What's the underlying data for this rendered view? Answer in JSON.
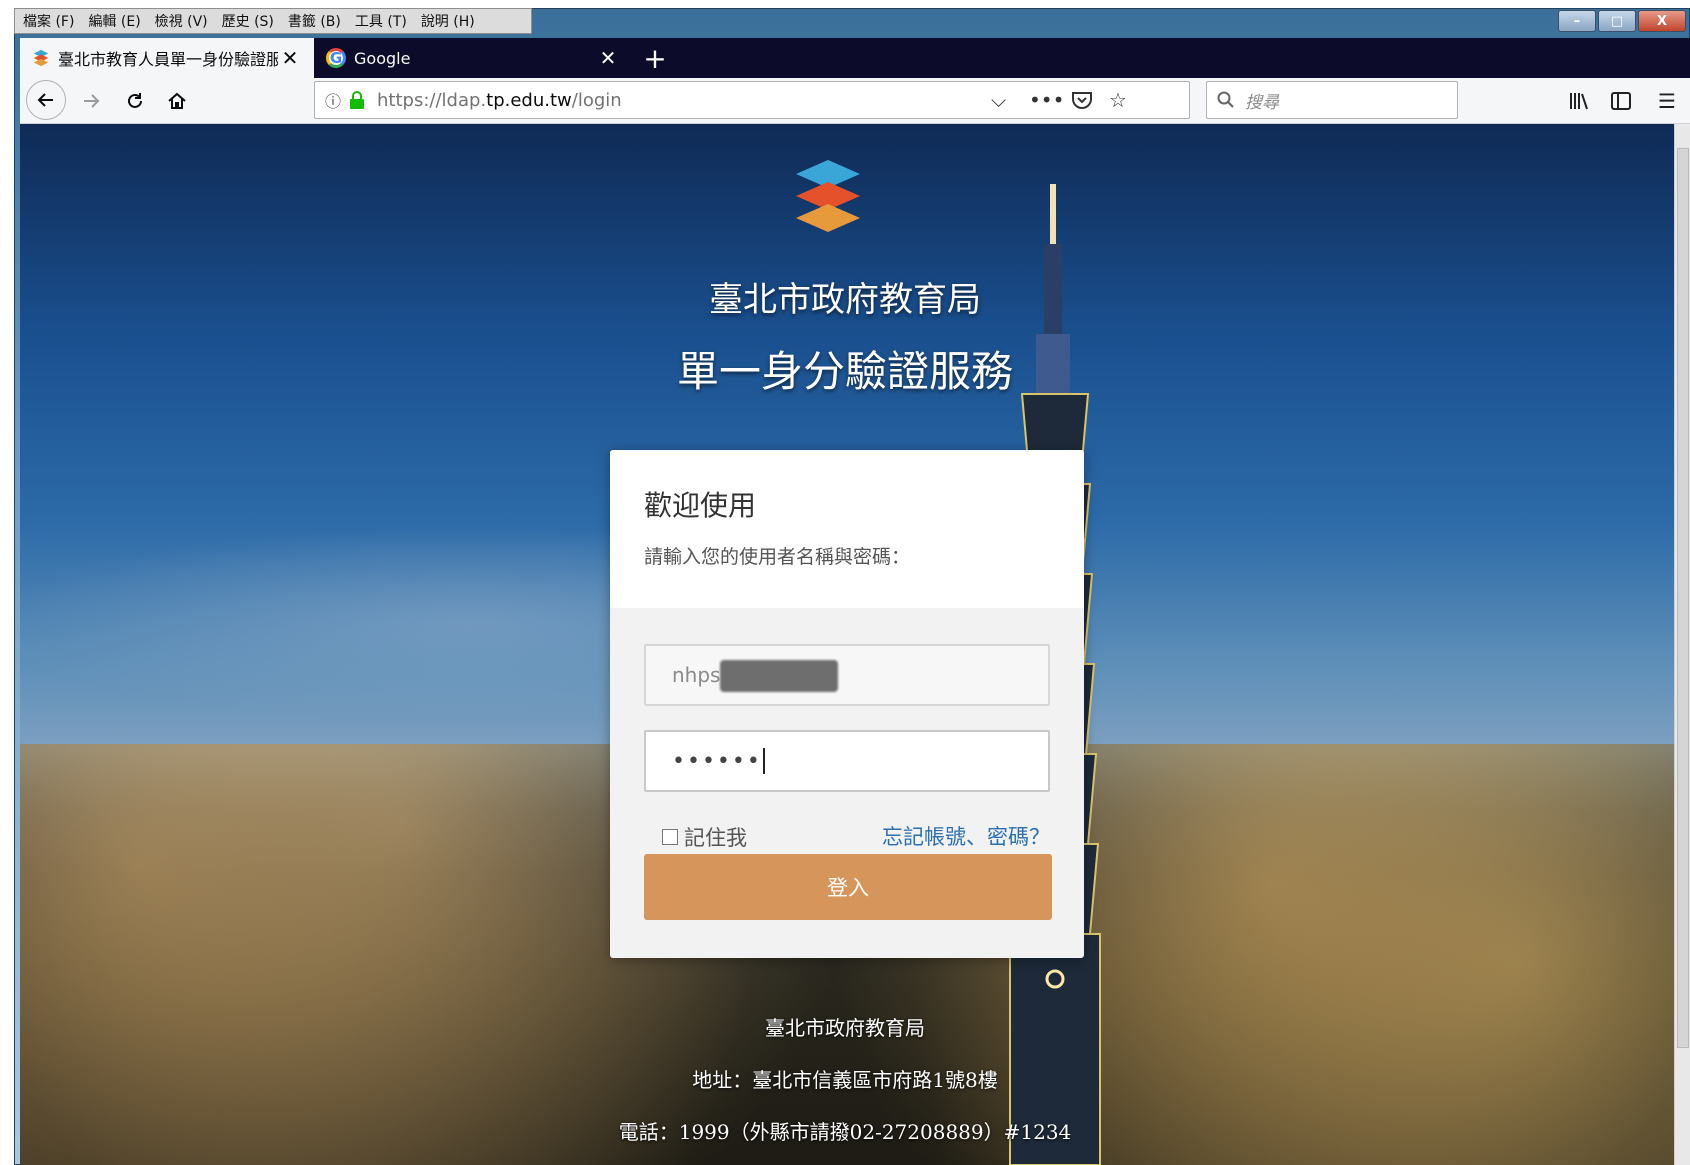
{
  "menubar": {
    "items": [
      "檔案 (F)",
      "編輯 (E)",
      "檢視 (V)",
      "歷史 (S)",
      "書籤 (B)",
      "工具 (T)",
      "說明 (H)"
    ]
  },
  "window_controls": {
    "minimize": "–",
    "maximize": "□",
    "close": "X"
  },
  "tabs": [
    {
      "title": "臺北市教育人員單一身份驗證服",
      "active": true,
      "close": "✕"
    },
    {
      "title": "Google",
      "active": false,
      "close": "✕"
    }
  ],
  "new_tab": "+",
  "nav": {
    "url_prefix": "https://ldap.",
    "url_domain": "tp.edu.tw",
    "url_path": "/login",
    "search_placeholder": "搜尋"
  },
  "page": {
    "org_title": "臺北市政府教育局",
    "service_title": "單一身分驗證服務",
    "login": {
      "welcome": "歡迎使用",
      "instruction": "請輸入您的使用者名稱與密碼：",
      "username_value": "nhps",
      "password_value": "••••••",
      "remember_label": "記住我",
      "forgot_link": "忘記帳號、密碼？",
      "submit_label": "登入",
      "button_color": "#d6955a",
      "link_color": "#2a6fb0"
    },
    "footer": {
      "org": "臺北市政府教育局",
      "address": "地址：臺北市信義區市府路1號8樓",
      "phone": "電話：1999（外縣市請撥02-27208889）#1234"
    }
  }
}
